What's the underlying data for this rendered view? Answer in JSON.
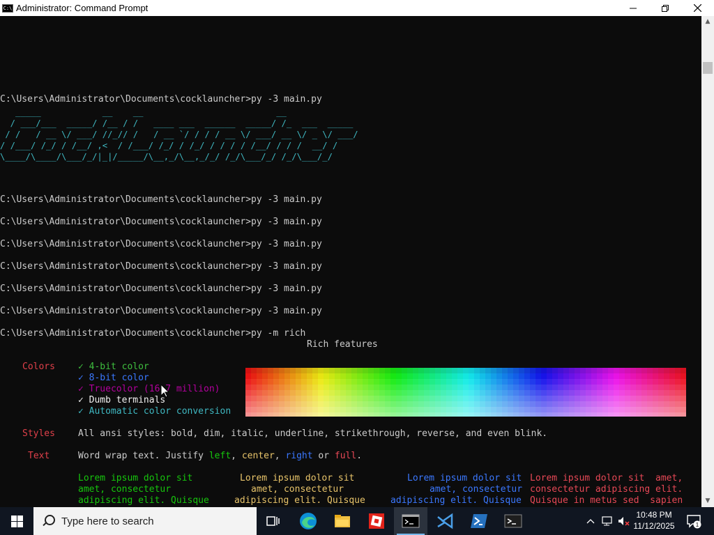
{
  "window": {
    "title": "Administrator: Command Prompt",
    "icon_text": "C:\\",
    "minimize_icon": "minimize-icon",
    "maximize_icon": "restore-icon",
    "close_icon": "close-icon"
  },
  "console": {
    "prompts": [
      "C:\\Users\\Administrator\\Documents\\cocklauncher>py -3 main.py",
      "C:\\Users\\Administrator\\Documents\\cocklauncher>py -3 main.py",
      "C:\\Users\\Administrator\\Documents\\cocklauncher>py -3 main.py",
      "C:\\Users\\Administrator\\Documents\\cocklauncher>py -3 main.py",
      "C:\\Users\\Administrator\\Documents\\cocklauncher>py -3 main.py",
      "C:\\Users\\Administrator\\Documents\\cocklauncher>py -3 main.py",
      "C:\\Users\\Administrator\\Documents\\cocklauncher>py -3 main.py",
      "C:\\Users\\Administrator\\Documents\\cocklauncher>py -m rich"
    ],
    "banner": [
      "   _____            __    __                          __             ",
      "  / ___/___  _____/ /__ / /   ____ ___  ______  _____/ /_  ___  _____",
      " / /   / __ \\/ ___/ //_// /   / __ `/ / / / __ \\/ ___/ __ \\/ _ \\/ ___/",
      "/ /___/ /_/ / /__/ ,<  / /___/ /_/ / /_/ / / / / /__/ / / /  __/ /    ",
      "\\____/\\____/\\___/_/|_|/_____/\\__,_/\\__,_/_/ /_/\\___/_/ /_/\\___/_/     "
    ],
    "rich_title": "Rich features",
    "colors_label": "Colors",
    "color_features": [
      {
        "text": "✓ 4-bit color",
        "color": "#3fbf3f"
      },
      {
        "text": "✓ 8-bit color",
        "color": "#3b78ff"
      },
      {
        "text": "✓ Truecolor (16.7 million)",
        "color": "#b4009e"
      },
      {
        "text": "✓ Dumb terminals",
        "color": "#f2f2f2"
      },
      {
        "text": "✓ Automatic color conversion",
        "color": "#3fb8c2"
      }
    ],
    "styles_label": "Styles",
    "styles_text": "All ansi styles: bold, dim, italic, underline, strikethrough, reverse, and even blink.",
    "text_label": "Text",
    "text_prefix": "Word wrap text. Justify ",
    "justify_left": "left",
    "comma1": ", ",
    "justify_center": "center",
    "comma2": ", ",
    "justify_right": "right",
    "or_word": " or ",
    "justify_full": "full",
    "period": ".",
    "lorem_left": [
      "Lorem ipsum dolor sit",
      "amet, consectetur",
      "adipiscing elit. Quisque"
    ],
    "lorem_center": [
      "Lorem ipsum dolor sit",
      "amet, consectetur",
      "adipiscing elit. Quisque"
    ],
    "lorem_right": [
      "Lorem ipsum dolor sit",
      "amet, consectetur",
      "adipiscing elit. Quisque"
    ],
    "lorem_full": [
      "Lorem ipsum dolor sit  amet,",
      "consectetur adipiscing elit.",
      "Quisque in metus sed  sapien"
    ]
  },
  "taskbar": {
    "search_placeholder": "Type here to search",
    "start_icon": "windows-start-icon",
    "apps": [
      {
        "name": "task-view-icon"
      },
      {
        "name": "edge-icon"
      },
      {
        "name": "file-explorer-icon"
      },
      {
        "name": "roblox-icon"
      },
      {
        "name": "command-prompt-icon",
        "active": true
      },
      {
        "name": "vscode-icon"
      },
      {
        "name": "powershell-icon"
      },
      {
        "name": "terminal-icon"
      }
    ],
    "time": "10:48 PM",
    "date": "11/12/2025",
    "notification_count": "1"
  },
  "colors": {
    "accent": "#76b9ed",
    "console_bg": "#0c0c0c",
    "console_fg": "#cccccc",
    "banner": "#3fb8c2",
    "label_red": "#e0404a"
  }
}
